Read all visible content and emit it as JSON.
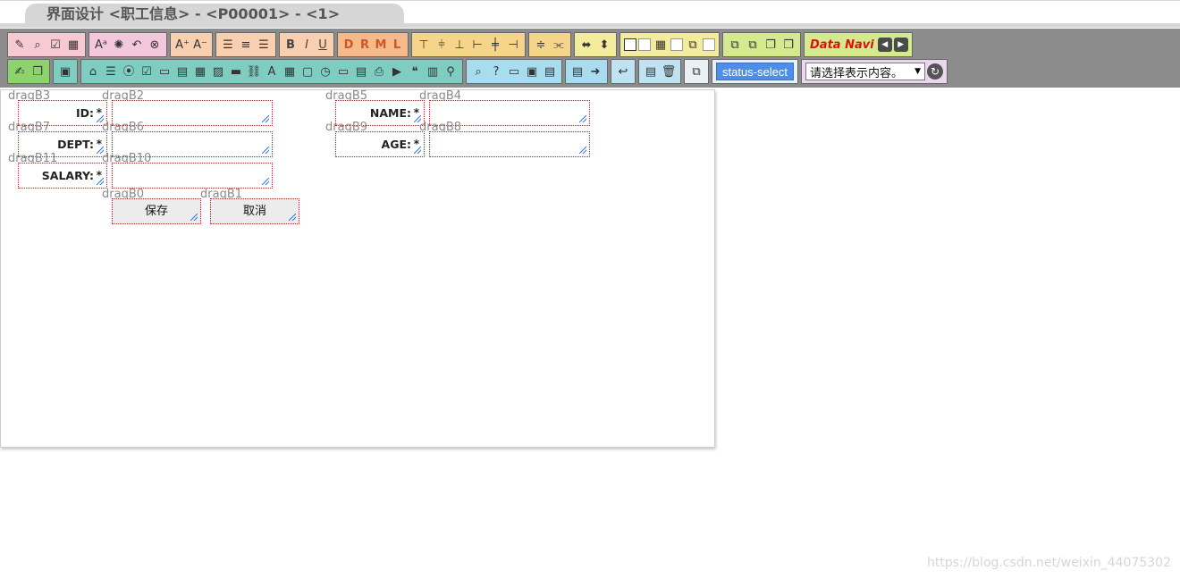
{
  "tab": {
    "title": "界面设计 <职工信息> - <P00001> - <1>"
  },
  "toolbar": {
    "format_letters": [
      "D",
      "R",
      "M",
      "L"
    ],
    "text_size": [
      "A⁺",
      "A⁻"
    ],
    "style_letters": [
      "B",
      "I",
      "U"
    ],
    "data_navi_label": "Data Navi",
    "status_select_label": "status-select",
    "select_value": "请选择表示内容。",
    "tooltip_letter": "A"
  },
  "form": {
    "tags": {
      "b3": "dragB3",
      "b2": "dragB2",
      "b5": "dragB5",
      "b4": "dragB4",
      "b7": "dragB7",
      "b6": "dragB6",
      "b9": "dragB9",
      "b8": "dragB8",
      "b11": "dragB11",
      "b10": "dragB10",
      "b0": "dragB0",
      "b1": "dragB1"
    },
    "fields": {
      "id": "ID:",
      "name": "NAME:",
      "dept": "DEPT:",
      "age": "AGE:",
      "salary": "SALARY:"
    },
    "required_mark": "*",
    "save_label": "保存",
    "cancel_label": "取消"
  },
  "watermark": "https://blog.csdn.net/weixin_44075302",
  "colors": {
    "toolbar_bg": "#8c8c8c",
    "status_btn": "#4f8ee8",
    "data_navi": "#e01010",
    "cell_border": "#b02020"
  }
}
